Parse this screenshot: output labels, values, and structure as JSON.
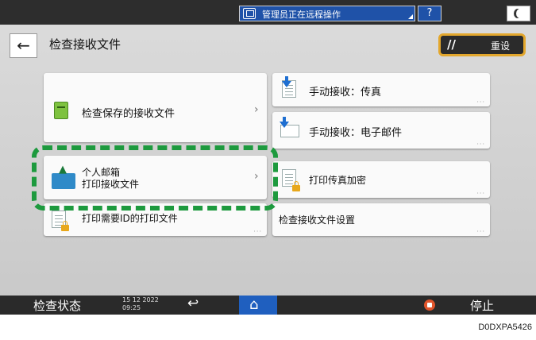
{
  "topbar": {
    "remote_status": "管理员正在远程操作",
    "help_label": "?"
  },
  "header": {
    "back_icon": "←",
    "title": "检查接收文件",
    "reset_label": "重设",
    "reset_icon": "//"
  },
  "tiles": {
    "check_saved": "检查保存的接收文件",
    "manual_fax": "手动接收：传真",
    "manual_email": "手动接收：电子邮件",
    "personal_box_line1": "个人邮箱",
    "personal_box_line2": "打印接收文件",
    "print_fax_encrypted": "打印传真加密",
    "print_id_files": "打印需要ID的打印文件",
    "check_settings": "检查接收文件设置"
  },
  "bottombar": {
    "check_status": "检查状态",
    "date": "15 12 2022",
    "time": "09:25",
    "undo_icon": "↩",
    "home_icon": "⌂",
    "stop_label": "停止"
  },
  "caption": "D0DXPA5426",
  "colors": {
    "accent_blue": "#1f5fbf",
    "highlight_green": "#1d9a3e",
    "reset_border": "#e3a72d",
    "stop_red": "#e0542b"
  }
}
